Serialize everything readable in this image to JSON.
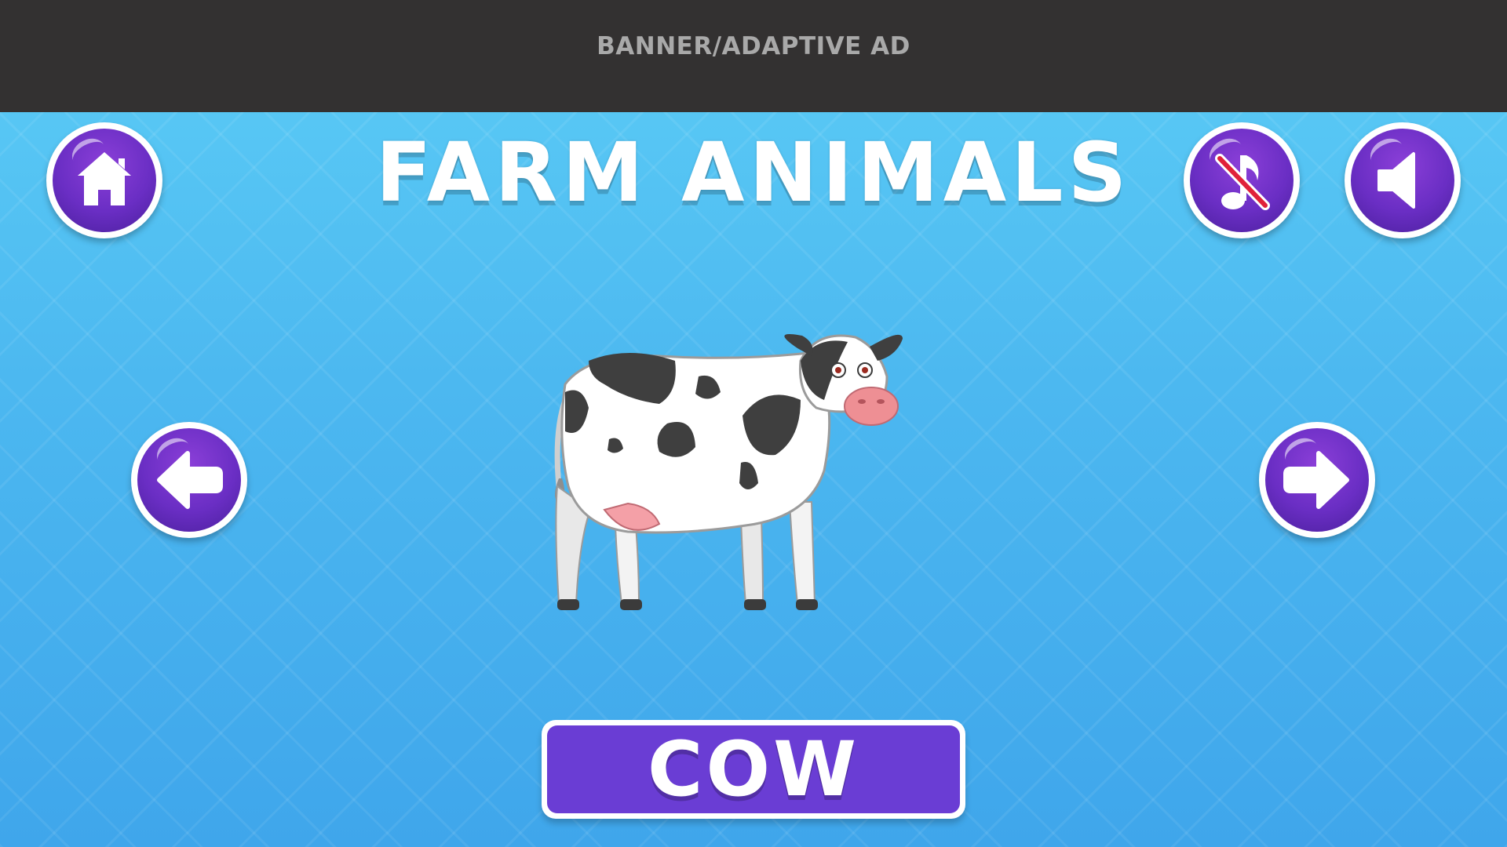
{
  "ad": {
    "label": "BANNER/ADAPTIVE AD"
  },
  "header": {
    "title": "FARM ANIMALS"
  },
  "buttons": {
    "home": "home-icon",
    "music": "music-off-icon",
    "sound": "speaker-icon",
    "previous": "arrow-left-icon",
    "next": "arrow-right-icon"
  },
  "card": {
    "animal_image": "cow",
    "animal_name": "COW"
  },
  "colors": {
    "background_top": "#5ccdf6",
    "background_bottom": "#3fa6eb",
    "ad_bar": "#333131",
    "button_purple": "#6a2ec4",
    "name_plate": "#6a3dd4",
    "mute_slash": "#e0213a"
  }
}
